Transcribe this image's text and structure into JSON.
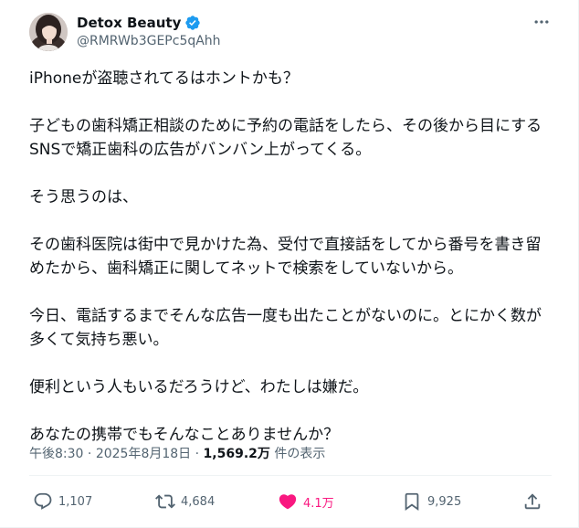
{
  "author": {
    "display_name": "Detox Beauty",
    "handle": "@RMRWb3GEPc5qAhh",
    "verified": true
  },
  "tweet": {
    "paragraphs": [
      [
        "iPhoneが盗聴されてるはホントかも？"
      ],
      [
        "子どもの歯科矯正相談のために予約の電話をしたら、その後から目にする",
        "SNSで矯正歯科の広告がバンバン上がってくる。"
      ],
      [
        "そう思うのは、"
      ],
      [
        "その歯科医院は街中で見かけた為、受付で直接話をしてから番号を書き留",
        "めたから、歯科矯正に関してネットで検索をしていないから。"
      ],
      [
        "今日、電話するまでそんな広告一度も出たことがないのに。とにかく数が",
        "多くて気持ち悪い。"
      ],
      [
        "便利という人もいるだろうけど、わたしは嫌だ。"
      ],
      [
        "あなたの携帯でもそんなことありませんか？"
      ]
    ]
  },
  "meta": {
    "time": "午後8:30",
    "separator": "·",
    "date": "2025年8月18日",
    "views": "1,569.2万",
    "views_suffix": "件の表示"
  },
  "actions": {
    "reply_count": "1,107",
    "retweet_count": "4,684",
    "like_count": "4.1万",
    "bookmark_count": "9,925"
  },
  "icons": {
    "verified": "verified-badge-icon",
    "more": "more-horizontal-icon",
    "reply": "reply-icon",
    "retweet": "retweet-icon",
    "like": "heart-icon",
    "bookmark": "bookmark-icon",
    "share": "share-icon"
  },
  "colors": {
    "text_primary": "#0f1419",
    "text_secondary": "#536471",
    "verified_blue": "#1d9bf0",
    "like_pink": "#f91880",
    "divider": "#eff3f4"
  }
}
